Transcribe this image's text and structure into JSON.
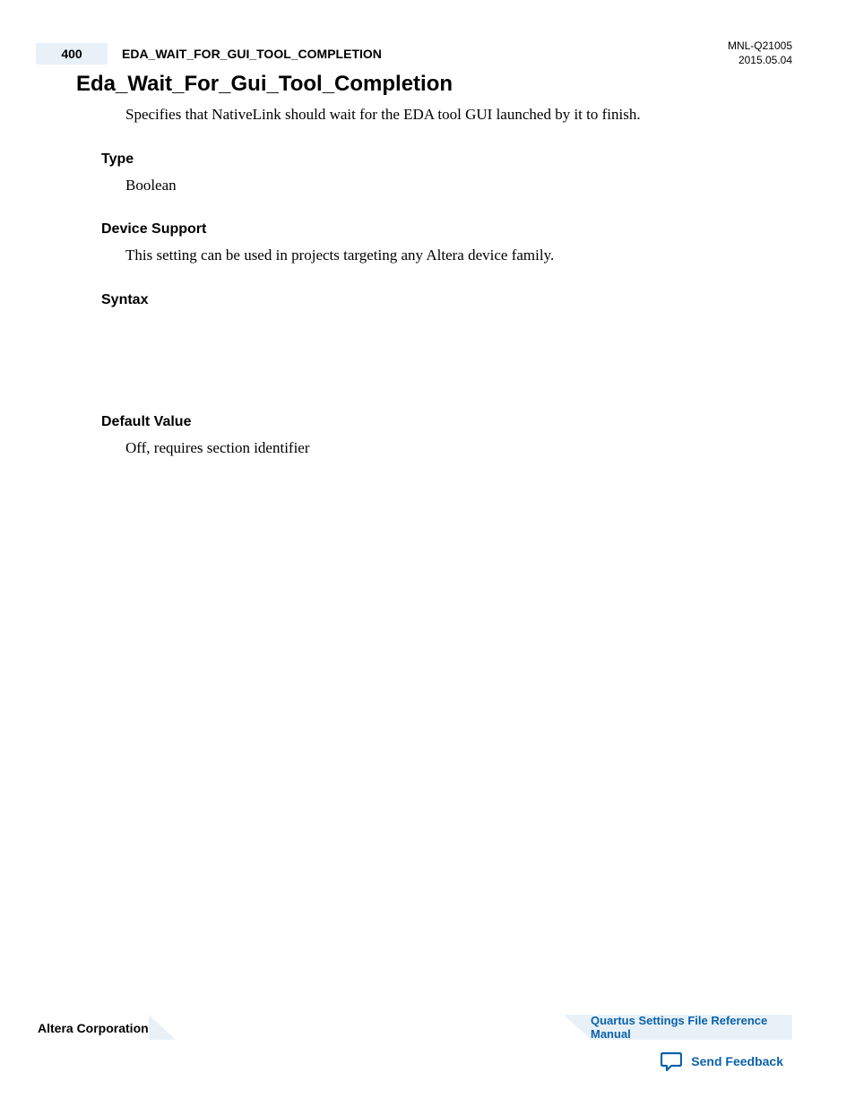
{
  "header": {
    "page_number": "400",
    "running_title": "EDA_WAIT_FOR_GUI_TOOL_COMPLETION",
    "doc_id": "MNL-Q21005",
    "doc_date": "2015.05.04"
  },
  "main": {
    "title": "Eda_Wait_For_Gui_Tool_Completion",
    "intro": "Specifies that NativeLink should wait for the EDA tool GUI launched by it to finish.",
    "sections": {
      "type_h": "Type",
      "type_body": "Boolean",
      "device_h": "Device Support",
      "device_body": "This setting can be used in projects targeting any Altera device family.",
      "syntax_h": "Syntax",
      "default_h": "Default Value",
      "default_body": "Off, requires section identifier"
    }
  },
  "footer": {
    "corp": "Altera Corporation",
    "manual_link": "Quartus Settings File Reference Manual",
    "feedback": "Send Feedback"
  }
}
